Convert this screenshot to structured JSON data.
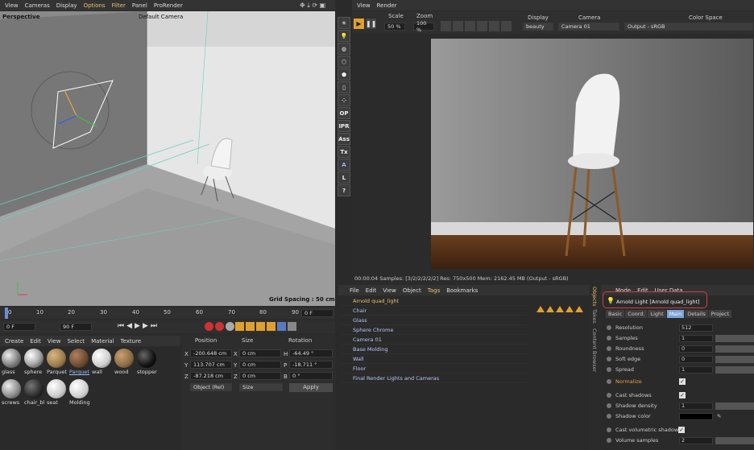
{
  "viewport": {
    "menu": [
      "View",
      "Cameras",
      "Display",
      "Options",
      "Filter",
      "Panel",
      "ProRender"
    ],
    "projection_label": "Perspective",
    "camera_label": "Default Camera",
    "grid_spacing": "Grid Spacing : 50 cm"
  },
  "timeline": {
    "ticks": [
      "0",
      "10",
      "20",
      "30",
      "40",
      "50",
      "60",
      "70",
      "80",
      "90"
    ],
    "current_frame": "0 F",
    "end_frame": "90 F",
    "start_field": "0 F",
    "end_field2": "90 F"
  },
  "materials": {
    "menu": [
      "Create",
      "Edit",
      "View",
      "Select",
      "Material",
      "Texture"
    ],
    "items": [
      {
        "label": "glass",
        "color": "#9a9a9a"
      },
      {
        "label": "sphere",
        "color": "#dcdcdc"
      },
      {
        "label": "Parquet",
        "color": "#9a7a4a"
      },
      {
        "label": "Parquet",
        "color": "#6b4a30"
      },
      {
        "label": "wall",
        "color": "#d8d8d8"
      },
      {
        "label": "wood",
        "color": "#8a6a44"
      },
      {
        "label": "stopper",
        "color": "#111111"
      },
      {
        "label": "screws",
        "color": "#8a8a8a"
      },
      {
        "label": "chair_bl",
        "color": "#2a2a2a"
      },
      {
        "label": "seat",
        "color": "#c8c8c8"
      },
      {
        "label": "Molding",
        "color": "#cfcfcf"
      }
    ]
  },
  "coords": {
    "headers": [
      "Position",
      "Size",
      "Rotation"
    ],
    "rows": [
      {
        "axis": "X",
        "pos": "-200.648 cm",
        "saxis": "X",
        "size": "0 cm",
        "raxis": "H",
        "rot": "-64.49 °"
      },
      {
        "axis": "Y",
        "pos": "113.707 cm",
        "saxis": "Y",
        "size": "0 cm",
        "raxis": "P",
        "rot": "-18.711 °"
      },
      {
        "axis": "Z",
        "pos": "-87.218 cm",
        "saxis": "Z",
        "size": "0 cm",
        "raxis": "B",
        "rot": "0 °"
      }
    ],
    "mode": "Object (Rel)",
    "size_mode": "Size",
    "apply": "Apply"
  },
  "render": {
    "menu": [
      "View",
      "Render"
    ],
    "scale_label": "Scale",
    "scale_value": "50 %",
    "zoom_label": "Zoom",
    "zoom_value": "100 %",
    "display_label": "Display",
    "display_value": "beauty",
    "camera_label": "Camera",
    "camera_value": "Camera 01",
    "colorspace_label": "Color Space",
    "colorspace_value": "Output - sRGB",
    "status": "00:00:04  Samples: [3/2/2/2/2/2]  Res: 750x500  Mem: 2162.45 MB  (Output - sRGB)"
  },
  "toolbar_icons": [
    "arnold-icon",
    "light-icon",
    "sphere-icon",
    "cube-icon",
    "box-icon",
    "file-icon",
    "dots-icon",
    "OP",
    "IPR",
    "Ass",
    "Tx",
    "A",
    "L",
    "?"
  ],
  "objects": {
    "menu": [
      "File",
      "Edit",
      "View",
      "Object",
      "Tags",
      "Bookmarks"
    ],
    "items": [
      "Arnold quad_light",
      "Chair",
      "Glass",
      "Sphere Chrome",
      "Camera 01",
      "Base Molding",
      "Wall",
      "Floor",
      "Final Render Lights and Cameras"
    ]
  },
  "side_tabs": [
    "Objects",
    "Takes",
    "Content Browser"
  ],
  "attributes": {
    "menu": [
      "Mode",
      "Edit",
      "User Data"
    ],
    "title": "Arnold Light [Arnold quad_light]",
    "tabs": [
      "Basic",
      "Coord.",
      "Light",
      "Main",
      "Details",
      "Project"
    ],
    "active_tab": "Main",
    "rows": [
      {
        "label": "Resolution",
        "value": "512"
      },
      {
        "label": "Samples",
        "value": "1"
      },
      {
        "label": "Roundness",
        "value": "0"
      },
      {
        "label": "Soft edge",
        "value": "0"
      },
      {
        "label": "Spread",
        "value": "1"
      }
    ],
    "normalize": "Normalize",
    "cast_shadows": "Cast shadows",
    "shadow_density_label": "Shadow density",
    "shadow_density": "1",
    "shadow_color_label": "Shadow color",
    "cast_volumetric": "Cast volumetric shadows",
    "volume_samples_label": "Volume samples",
    "volume_samples": "2"
  }
}
